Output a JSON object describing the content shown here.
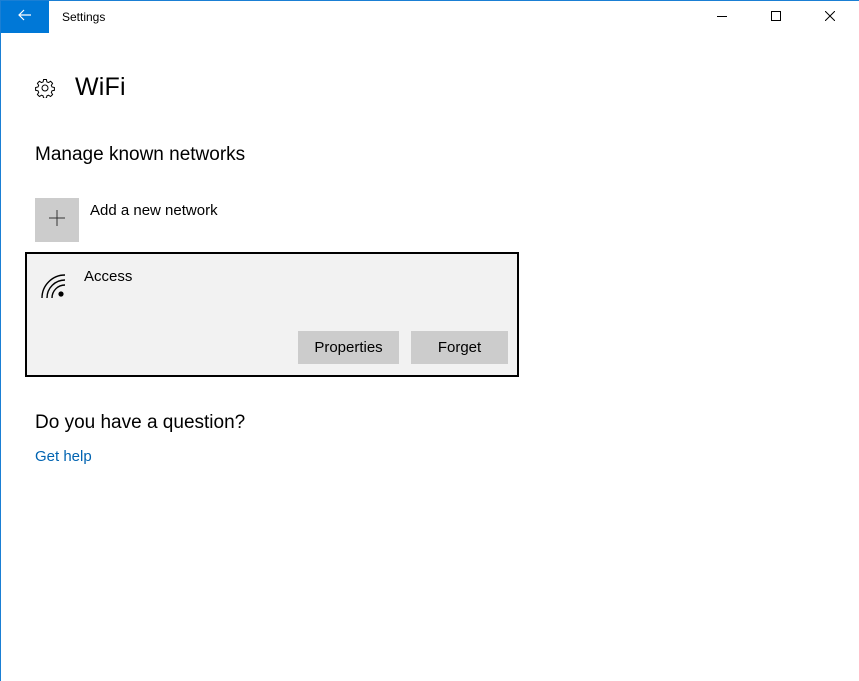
{
  "window": {
    "title": "Settings",
    "back_icon": "arrow-left-icon",
    "controls": [
      "minimize-icon",
      "maximize-icon",
      "close-icon"
    ],
    "accent_color": "#0078d7"
  },
  "header": {
    "icon": "gear-icon",
    "title": "WiFi"
  },
  "known_networks": {
    "section_title": "Manage known networks",
    "add_label": "Add a new network",
    "add_icon": "plus-icon",
    "networks": [
      {
        "name": "Access",
        "icon": "wifi-signal-icon",
        "selected": true,
        "actions": {
          "properties": "Properties",
          "forget": "Forget"
        }
      }
    ]
  },
  "help": {
    "question": "Do you have a question?",
    "link": "Get help",
    "link_color": "#0063b1"
  }
}
